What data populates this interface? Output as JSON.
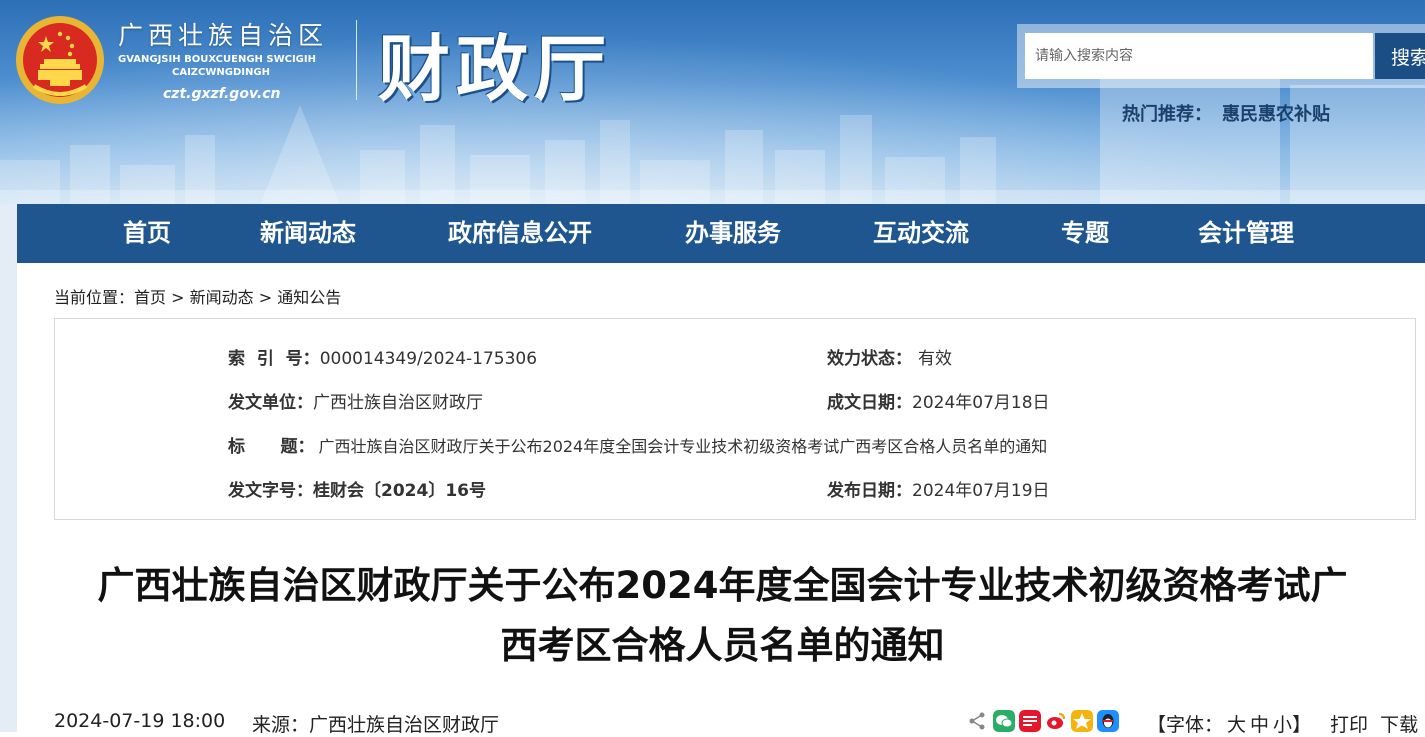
{
  "header": {
    "region_name": "广西壮族自治区",
    "region_zhuang": "GVANGJSIH BOUXCUENGH SWCIGIH\nCAIZCWNGDINGH",
    "site_url": "czt.gxzf.gov.cn",
    "dept_name": "财政厅",
    "search": {
      "placeholder": "请输入搜索内容",
      "button_label": "搜索"
    },
    "hot": {
      "label": "热门推荐：",
      "link": "惠民惠农补贴"
    }
  },
  "nav": {
    "items": [
      {
        "label": "首页"
      },
      {
        "label": "新闻动态"
      },
      {
        "label": "政府信息公开"
      },
      {
        "label": "办事服务"
      },
      {
        "label": "互动交流"
      },
      {
        "label": "专题"
      },
      {
        "label": "会计管理"
      }
    ]
  },
  "breadcrumb": {
    "prefix": "当前位置：",
    "items": [
      "首页",
      "新闻动态",
      "通知公告"
    ],
    "separator": " > "
  },
  "meta": {
    "index_label": "索  引  号：",
    "index_value": "000014349/2024-175306",
    "status_label": "效力状态：",
    "status_value": "有效",
    "issuer_label": "发文单位：",
    "issuer_value": "广西壮族自治区财政厅",
    "created_label": "成文日期：",
    "created_value": "2024年07月18日",
    "title_label": "标      题：",
    "title_value": "广西壮族自治区财政厅关于公布2024年度全国会计专业技术初级资格考试广西考区合格人员名单的通知",
    "doc_no_label": "发文字号：",
    "doc_no_value": "桂财会〔2024〕16号",
    "published_label": "发布日期：",
    "published_value": "2024年07月19日"
  },
  "article": {
    "title_line1": "广西壮族自治区财政厅关于公布2024年度全国会计专业技术初级资格考试广",
    "title_line2": "西考区合格人员名单的通知",
    "datetime": "2024-07-19 18:00",
    "source_label": "来源：",
    "source": "广西壮族自治区财政厅",
    "font_label": "【字体：",
    "font_options": [
      "大",
      "中",
      "小"
    ],
    "font_close": "】",
    "print": "打印",
    "download": "下载"
  },
  "colors": {
    "nav_bg": "#1f568f",
    "search_btn": "#1a4e84",
    "banner_top": "#2d6fb6",
    "wechat": "#2aae67",
    "weibo": "#e6162d",
    "qzone": "#f4b40c",
    "qq": "#1e90ff"
  },
  "icons": [
    "emblem-icon",
    "share-icon",
    "wechat-icon",
    "toutiao-icon",
    "weibo-icon",
    "qzone-icon",
    "qq-icon"
  ]
}
